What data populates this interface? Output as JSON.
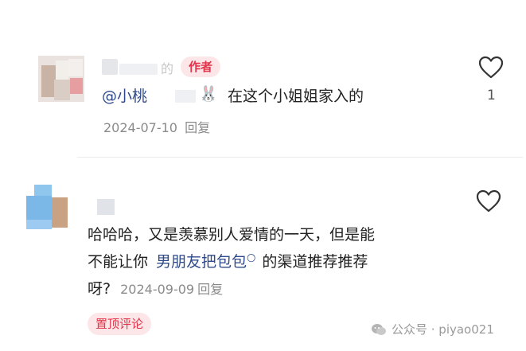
{
  "comment1": {
    "username_visible": "的",
    "author_badge": "作者",
    "mention": "@小桃",
    "emoji": "🐰",
    "text": "在这个小姐姐家入的",
    "date": "2024-07-10",
    "reply_label": "回复",
    "like_count": "1",
    "like_icon": "heart-outline-icon"
  },
  "comment2": {
    "line1": "哈哈哈，又是羡慕别人爱情的一天，但是能",
    "line2_prefix": "不能让你",
    "link_text": "男朋友把包包",
    "link_icon": "search-icon",
    "line2_suffix": "的渠道推荐推荐",
    "line3": "呀?",
    "date": "2024-09-09",
    "reply_label": "回复",
    "like_icon": "heart-outline-icon",
    "pinned_badge": "置顶评论"
  },
  "watermark": {
    "text": "公众号 · piyao021",
    "icon": "wechat-icon"
  },
  "colors": {
    "link": "#2f4a8a",
    "badge_text": "#e2344a",
    "badge_bg": "#fde6e8",
    "meta": "#8a8a8a"
  }
}
